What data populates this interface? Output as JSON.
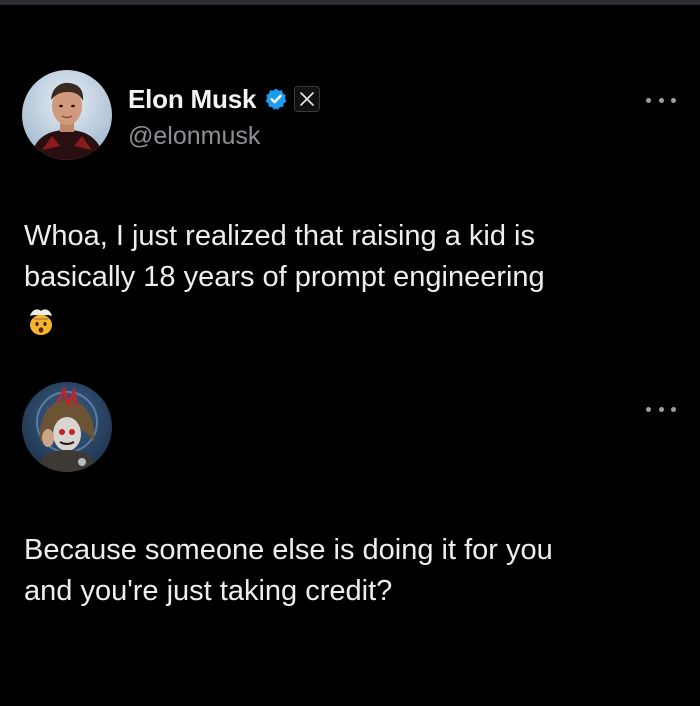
{
  "posts": [
    {
      "author": {
        "name": "Elon Musk",
        "handle": "@elonmusk",
        "verified": true,
        "affiliate_badge": "x-logo-icon"
      },
      "text_lines": [
        "Whoa, I just realized that raising a kid is",
        "basically 18 years of prompt engineering"
      ],
      "emoji": "exploding-head-icon",
      "menu_icon": "more-options-icon"
    },
    {
      "author": {
        "name": "",
        "handle": ""
      },
      "text_lines": [
        "Because someone else is doing it for you",
        "and you're just taking credit?"
      ],
      "menu_icon": "more-options-icon"
    }
  ],
  "colors": {
    "background": "#000000",
    "text_primary": "#eceef0",
    "text_secondary": "#8b9096",
    "verified_badge": "#1d9bf0"
  }
}
